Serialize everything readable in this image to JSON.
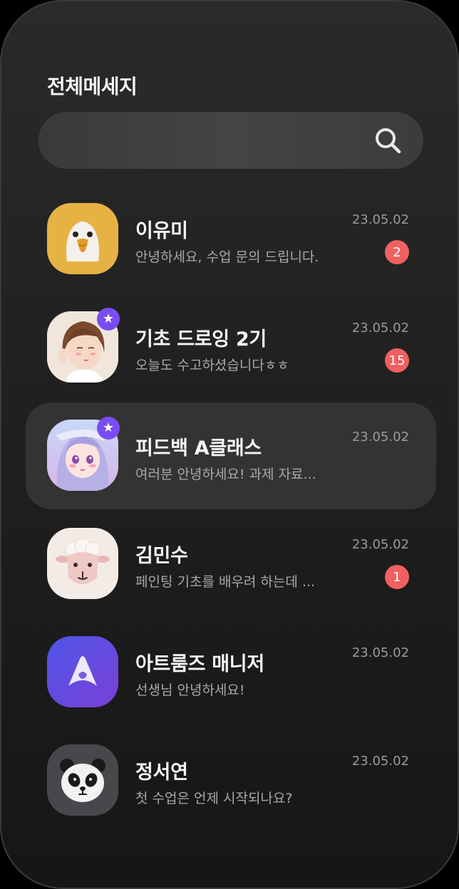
{
  "header": {
    "title": "전체메세지"
  },
  "search": {
    "placeholder": ""
  },
  "chats": [
    {
      "name": "이유미",
      "preview": "안녕하세요, 수업 문의 드립니다.",
      "date": "23.05.02",
      "badge": "2",
      "avatar": "eagle-avatar",
      "avatar_color": "#e6b243",
      "starred": false,
      "active": false
    },
    {
      "name": "기초 드로잉 2기",
      "preview": "오늘도 수고하셨습니다ㅎㅎ",
      "date": "23.05.02",
      "badge": "15",
      "avatar": "girl-illustration-avatar",
      "avatar_color": "#f3e4d8",
      "starred": true,
      "active": false
    },
    {
      "name": "피드백 A클래스",
      "preview": "여러분 안녕하세요! 과제 자료...",
      "date": "23.05.02",
      "badge": "",
      "avatar": "anime-girl-avatar",
      "avatar_color": "#b9a8e6",
      "starred": true,
      "active": true
    },
    {
      "name": "김민수",
      "preview": "페인팅 기초를 배우려 하는데 ...",
      "date": "23.05.02",
      "badge": "1",
      "avatar": "sheep-avatar",
      "avatar_color": "#f3ece6",
      "starred": false,
      "active": false
    },
    {
      "name": "아트룸즈 매니저",
      "preview": "선생님 안녕하세요!",
      "date": "23.05.02",
      "badge": "",
      "avatar": "artrooms-logo-avatar",
      "avatar_color": "#6a4be0",
      "starred": false,
      "active": false
    },
    {
      "name": "정서연",
      "preview": "첫 수업은 언제 시작되나요?",
      "date": "23.05.02",
      "badge": "",
      "avatar": "panda-avatar",
      "avatar_color": "#48484c",
      "starred": false,
      "active": false
    }
  ],
  "colors": {
    "badge": "#f06060",
    "star": "#7a4df2",
    "active_row": "#333333"
  }
}
